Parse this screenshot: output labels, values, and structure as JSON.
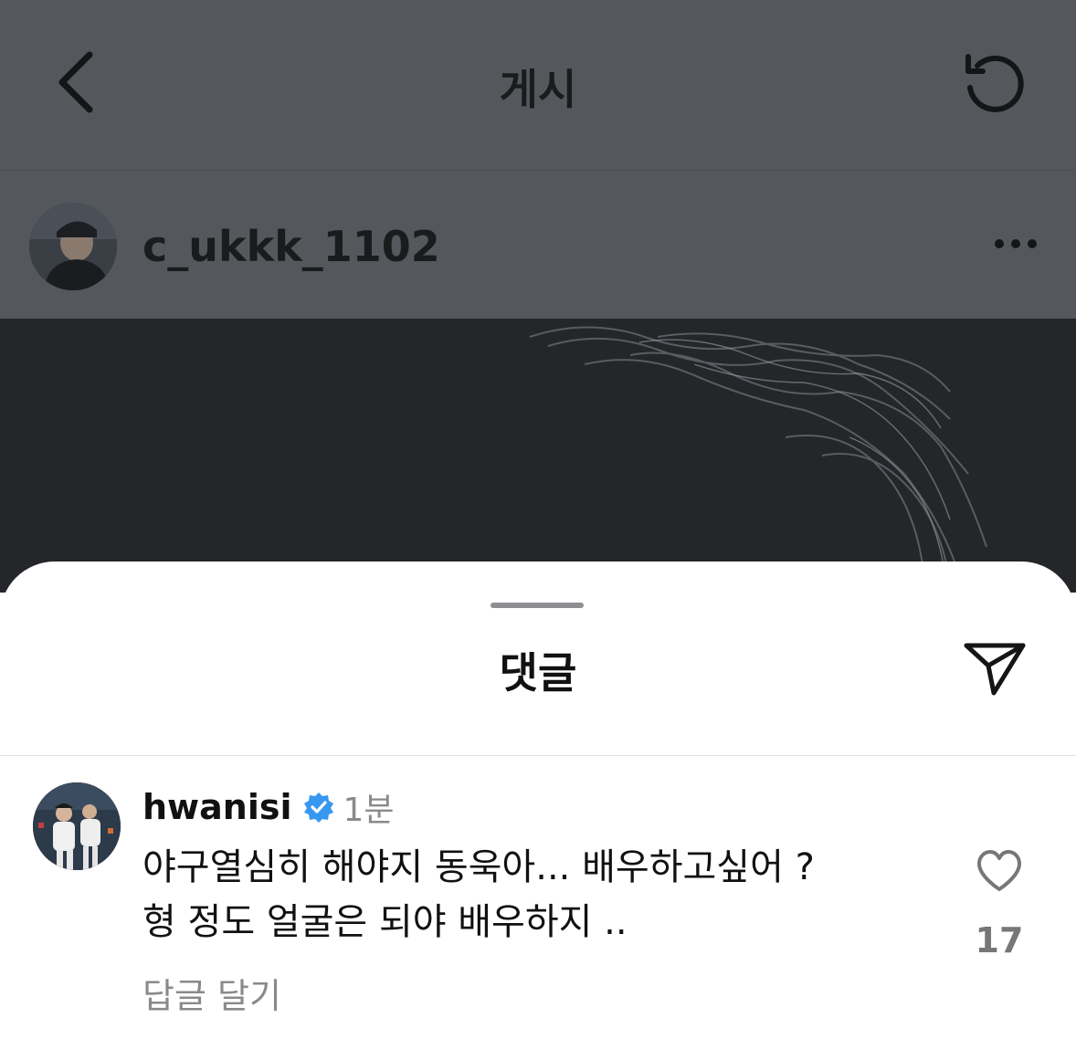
{
  "nav": {
    "title": "게시",
    "back_icon": "chevron-left-icon",
    "refresh_icon": "refresh-icon"
  },
  "post": {
    "author_username": "c_ukkk_1102",
    "more_icon": "more-horizontal-icon"
  },
  "comments_sheet": {
    "title": "댓글",
    "share_icon": "send-icon"
  },
  "comment": {
    "username": "hwanisi",
    "verified": true,
    "time": "1분",
    "text_lines": [
      "야구열심히 해야지 동욱아... 배우하고싶어 ?",
      "형 정도 얼굴은 되야 배우하지 .."
    ],
    "reply_label": "답글 달기",
    "likes": "17",
    "like_icon": "heart-icon"
  },
  "colors": {
    "dim_overlay": "#54585c",
    "post_image_bg": "#24262a",
    "verified_blue": "#3897f0",
    "secondary_text": "#8a8a8a"
  }
}
